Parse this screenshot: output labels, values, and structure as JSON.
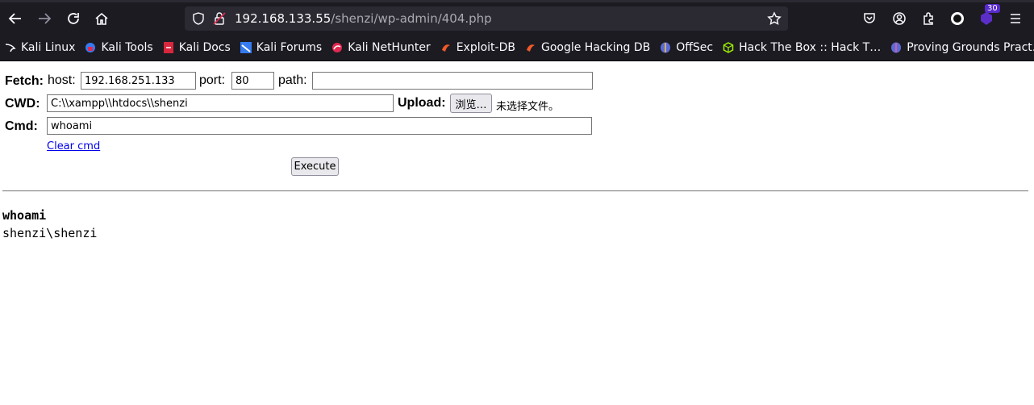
{
  "browser": {
    "url_host": "192.168.133.55",
    "url_path": "/shenzi/wp-admin/404.php",
    "badge_count": "30"
  },
  "bookmarks": [
    {
      "label": "Kali Linux",
      "icon": "kali-dragon-icon"
    },
    {
      "label": "Kali Tools",
      "icon": "kali-tools-icon"
    },
    {
      "label": "Kali Docs",
      "icon": "kali-docs-icon"
    },
    {
      "label": "Kali Forums",
      "icon": "kali-forums-icon"
    },
    {
      "label": "Kali NetHunter",
      "icon": "nethunter-icon"
    },
    {
      "label": "Exploit-DB",
      "icon": "exploit-db-icon"
    },
    {
      "label": "Google Hacking DB",
      "icon": "ghdb-icon"
    },
    {
      "label": "OffSec",
      "icon": "offsec-icon"
    },
    {
      "label": "Hack The Box :: Hack T…",
      "icon": "htb-icon"
    },
    {
      "label": "Proving Grounds Pract…",
      "icon": "proving-grounds-icon"
    }
  ],
  "form": {
    "fetch_label": "Fetch:",
    "host_label": "host:",
    "host_value": "192.168.251.133",
    "port_label": "port:",
    "port_value": "80",
    "path_label": "path:",
    "path_value": "",
    "cwd_label": "CWD:",
    "cwd_value": "C:\\\\xampp\\\\htdocs\\\\shenzi",
    "upload_label": "Upload:",
    "browse_label": "浏览…",
    "no_file_text": "未选择文件。",
    "cmd_label": "Cmd:",
    "cmd_value": "whoami",
    "clear_cmd": "Clear cmd",
    "execute_label": "Execute"
  },
  "output": {
    "command": "whoami",
    "result": "shenzi\\shenzi"
  }
}
